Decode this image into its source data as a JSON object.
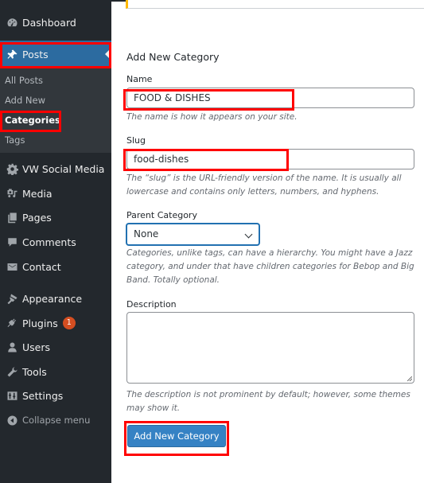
{
  "sidebar": {
    "items": [
      {
        "label": "Dashboard",
        "icon": "dashboard-icon"
      },
      {
        "label": "Posts",
        "icon": "pin-icon",
        "active": true
      },
      {
        "label": "VW Social Media",
        "icon": "gear-icon"
      },
      {
        "label": "Media",
        "icon": "media-icon"
      },
      {
        "label": "Pages",
        "icon": "pages-icon"
      },
      {
        "label": "Comments",
        "icon": "comment-icon"
      },
      {
        "label": "Contact",
        "icon": "envelope-icon"
      },
      {
        "label": "Appearance",
        "icon": "paintbrush-icon"
      },
      {
        "label": "Plugins",
        "icon": "plug-icon",
        "badge": "1"
      },
      {
        "label": "Users",
        "icon": "user-icon"
      },
      {
        "label": "Tools",
        "icon": "wrench-icon"
      },
      {
        "label": "Settings",
        "icon": "settings-icon"
      }
    ],
    "submenu": [
      {
        "label": "All Posts"
      },
      {
        "label": "Add New"
      },
      {
        "label": "Categories",
        "current": true
      },
      {
        "label": "Tags"
      }
    ],
    "collapse_label": "Collapse menu"
  },
  "form": {
    "title": "Add New Category",
    "name_label": "Name",
    "name_value": "FOOD & DISHES",
    "name_hint": "The name is how it appears on your site.",
    "slug_label": "Slug",
    "slug_value": "food-dishes",
    "slug_hint": "The “slug” is the URL-friendly version of the name. It is usually all lowercase and contains only letters, numbers, and hyphens.",
    "parent_label": "Parent Category",
    "parent_value": "None",
    "parent_hint": "Categories, unlike tags, can have a hierarchy. You might have a Jazz category, and under that have children categories for Bebop and Big Band. Totally optional.",
    "description_label": "Description",
    "description_value": "",
    "description_hint": "The description is not prominent by default; however, some themes may show it.",
    "submit_label": "Add New Category"
  },
  "colors": {
    "sidebar_bg": "#23282d",
    "active_bg": "#2c6ba0",
    "button_bg": "#3582c4",
    "badge_bg": "#d54e21",
    "highlight": "#ff0000",
    "notice_border": "#ffb900"
  }
}
